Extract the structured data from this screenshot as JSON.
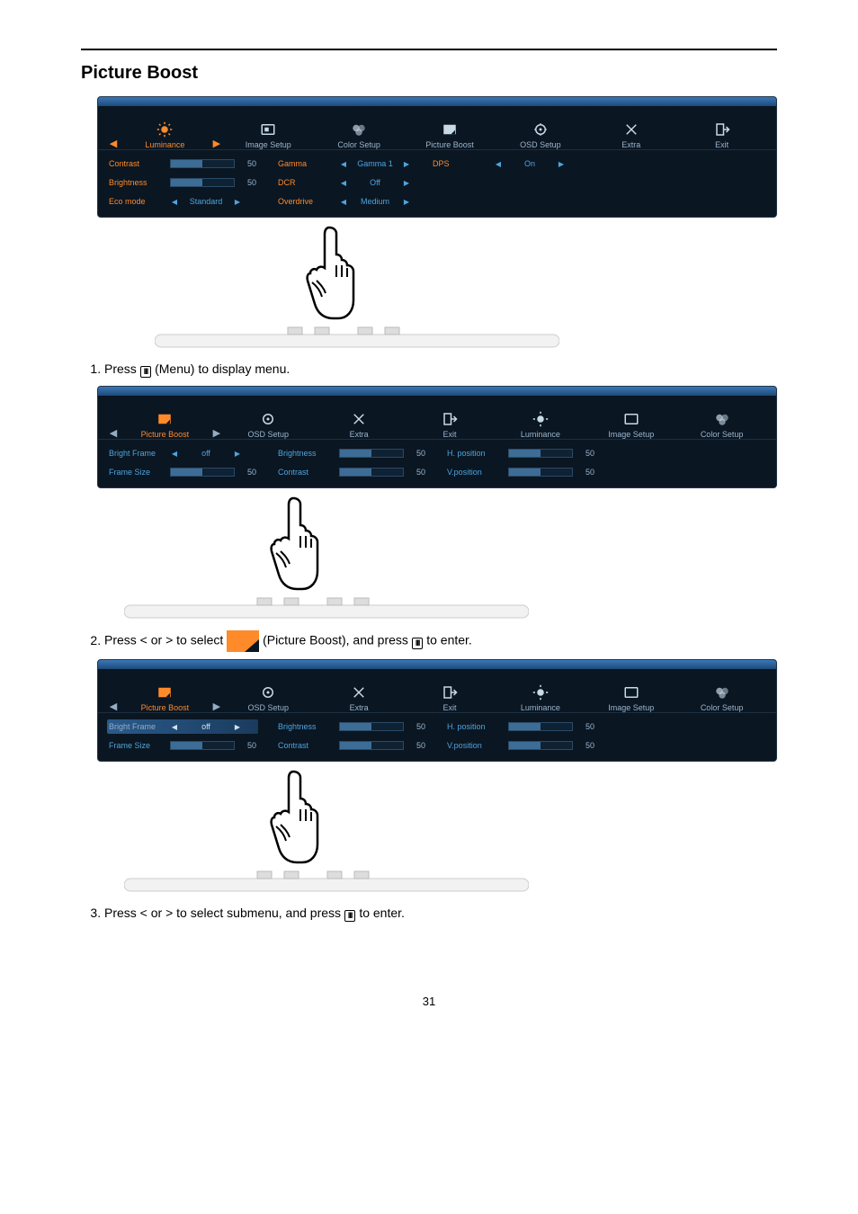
{
  "section_title": "Picture Boost",
  "page_number": "31",
  "steps": {
    "s1_a": "Press ",
    "s1_b": " (Menu) to display menu.",
    "s2_a": "Press < or > to select ",
    "s2_b": " (Picture Boost), and press ",
    "s2_c": " to enter.",
    "s3_a": "Press < or > to select submenu, and press ",
    "s3_b": "  to enter."
  },
  "panel1": {
    "tabs": [
      "Luminance",
      "Image Setup",
      "Color Setup",
      "Picture Boost",
      "OSD Setup",
      "Extra",
      "Exit"
    ],
    "col1": [
      {
        "label": "Contrast",
        "value": "50"
      },
      {
        "label": "Brightness",
        "value": "50"
      },
      {
        "label": "Eco mode",
        "optval": "Standard"
      }
    ],
    "col2": [
      {
        "label": "Gamma",
        "optval": "Gamma 1"
      },
      {
        "label": "DCR",
        "optval": "Off"
      },
      {
        "label": "Overdrive",
        "optval": "Medium"
      }
    ],
    "col3": [
      {
        "label": "DPS",
        "optval": "On"
      }
    ]
  },
  "panel2": {
    "tabs": [
      "Picture Boost",
      "OSD Setup",
      "Extra",
      "Exit",
      "Luminance",
      "Image Setup",
      "Color Setup"
    ],
    "col1": [
      {
        "label": "Bright Frame",
        "optval": "off"
      },
      {
        "label": "Frame Size",
        "value": "50"
      }
    ],
    "col2": [
      {
        "label": "Brightness",
        "value": "50"
      },
      {
        "label": "Contrast",
        "value": "50"
      }
    ],
    "col3": [
      {
        "label": "H. position",
        "value": "50"
      },
      {
        "label": "V.position",
        "value": "50"
      }
    ]
  },
  "panel3": {
    "tabs": [
      "Picture Boost",
      "OSD Setup",
      "Extra",
      "Exit",
      "Luminance",
      "Image Setup",
      "Color Setup"
    ],
    "col1": [
      {
        "label": "Bright Frame",
        "optval": "off",
        "highlighted": true
      },
      {
        "label": "Frame Size",
        "value": "50"
      }
    ],
    "col2": [
      {
        "label": "Brightness",
        "value": "50"
      },
      {
        "label": "Contrast",
        "value": "50"
      }
    ],
    "col3": [
      {
        "label": "H. position",
        "value": "50"
      },
      {
        "label": "V.position",
        "value": "50"
      }
    ]
  }
}
